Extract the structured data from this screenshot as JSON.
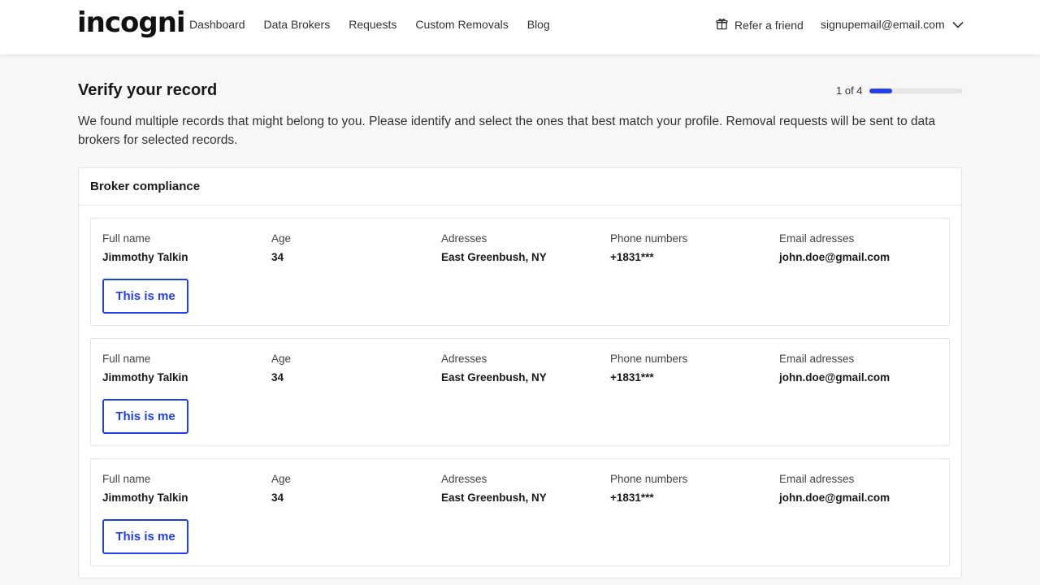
{
  "header": {
    "logo": "incogni",
    "nav": [
      "Dashboard",
      "Data Brokers",
      "Requests",
      "Custom Removals",
      "Blog"
    ],
    "refer": "Refer a friend",
    "account_email": "signupemail@email.com"
  },
  "page": {
    "title": "Verify your record",
    "progress_label": "1 of 4",
    "progress_fraction": 0.25,
    "intro": "We found multiple records that might belong to you. Please identify and select the ones that best match your profile. Removal requests will be sent to data brokers for selected records."
  },
  "panel": {
    "title": "Broker compliance",
    "columns": [
      "Full name",
      "Age",
      "Adresses",
      "Phone numbers",
      "Email adresses"
    ],
    "records": [
      {
        "values": [
          "Jimmothy Talkin",
          "34",
          "East Greenbush, NY",
          "+1831***",
          "john.doe@gmail.com"
        ],
        "button": "This is me"
      },
      {
        "values": [
          "Jimmothy Talkin",
          "34",
          "East Greenbush, NY",
          "+1831***",
          "john.doe@gmail.com"
        ],
        "button": "This is me"
      },
      {
        "values": [
          "Jimmothy Talkin",
          "34",
          "East Greenbush, NY",
          "+1831***",
          "john.doe@gmail.com"
        ],
        "button": "This is me"
      }
    ]
  },
  "colors": {
    "accent": "#1f3ff0",
    "background": "#f7f7f7"
  },
  "icons": {
    "refer": "gift-icon",
    "account": "chevron-down-icon"
  }
}
